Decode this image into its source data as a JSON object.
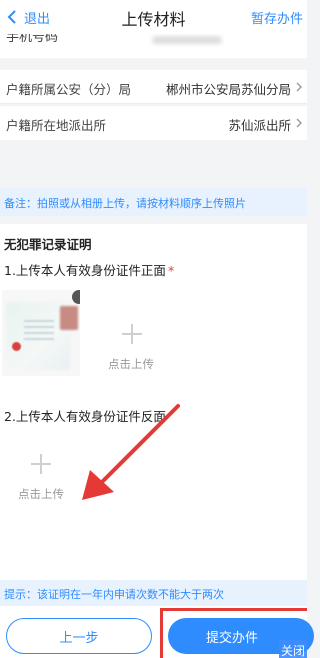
{
  "header": {
    "back_label": "退出",
    "title": "上传材料",
    "save_draft_label": "暂存办件"
  },
  "form": {
    "phone_label": "手机号码",
    "rows": [
      {
        "label": "户籍所属公安（分）局",
        "value": "郴州市公安局苏仙分局"
      },
      {
        "label": "户籍所在地派出所",
        "value": "苏仙派出所"
      }
    ]
  },
  "note": "备注：拍照或从相册上传，请按材料顺序上传照片",
  "material": {
    "section_title": "无犯罪记录证明",
    "item1_label": "1.上传本人有效身份证件正面",
    "required_mark": "*",
    "item2_label": "2.上传本人有效身份证件反面",
    "upload_label": "点击上传"
  },
  "tip": "提示：该证明在一年内申请次数不能大于两次",
  "footer": {
    "prev_label": "上一步",
    "submit_label": "提交办件",
    "close_label": "关闭"
  },
  "colors": {
    "accent": "#2f8cff",
    "annotation_red": "#e53935"
  },
  "icons": [
    "chevron-left-icon",
    "chevron-right-icon",
    "plus-icon",
    "delete-icon",
    "arrow-annotation"
  ]
}
